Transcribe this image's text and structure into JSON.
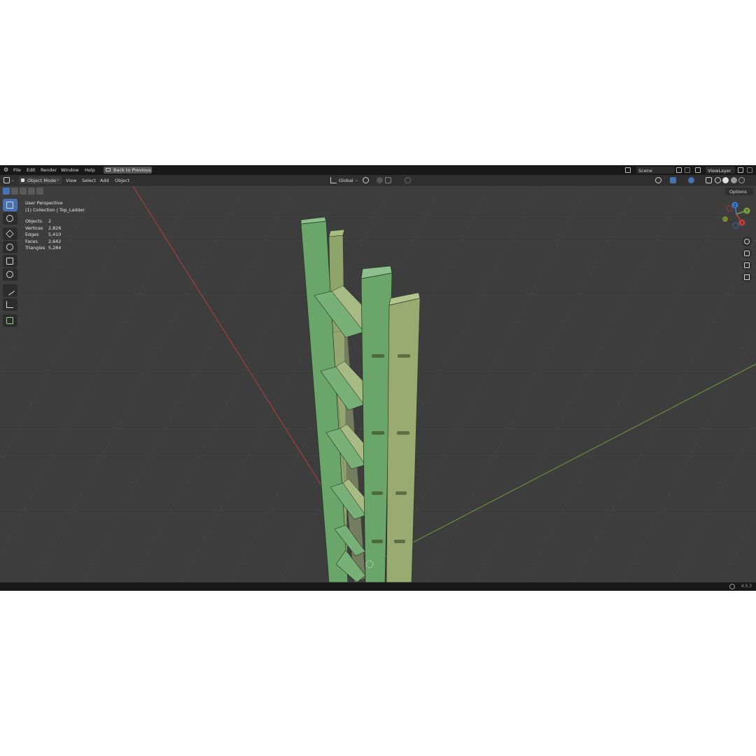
{
  "menu": {
    "items": [
      "File",
      "Edit",
      "Render",
      "Window",
      "Help"
    ],
    "back_button": "Back to Previous",
    "scene": "Scene",
    "view_layer": "ViewLayer"
  },
  "header": {
    "mode": "Object Mode",
    "menus": [
      "View",
      "Select",
      "Add",
      "Object"
    ],
    "orientation": "Global",
    "options": "Options"
  },
  "viewport": {
    "perspective": "User Perspective",
    "collection": "(1) Collection | Top_Ladder",
    "stats": [
      {
        "label": "Objects",
        "value": "2"
      },
      {
        "label": "Vertices",
        "value": "2,826"
      },
      {
        "label": "Edges",
        "value": "5,410"
      },
      {
        "label": "Faces",
        "value": "2,642"
      },
      {
        "label": "Triangles",
        "value": "5,284"
      }
    ],
    "gizmo_axes": [
      "X",
      "Y",
      "Z"
    ]
  },
  "status": {
    "version": "4.5.3"
  },
  "colors": {
    "accent": "#4772b3",
    "viewport_bg": "#3d3d3d",
    "ladder_green": "#6aa56a",
    "axis_x": "#c8403f",
    "axis_y": "#7ba23a",
    "axis_z": "#3b7fd4"
  },
  "icons": [
    "blender-logo",
    "select-box-icon",
    "cursor-icon",
    "move-icon",
    "rotate-icon",
    "scale-icon",
    "transform-icon",
    "annotate-icon",
    "measure-icon",
    "add-cube-icon",
    "zoom-icon",
    "hand-icon",
    "camera-icon",
    "grid-icon",
    "globe-icon"
  ]
}
